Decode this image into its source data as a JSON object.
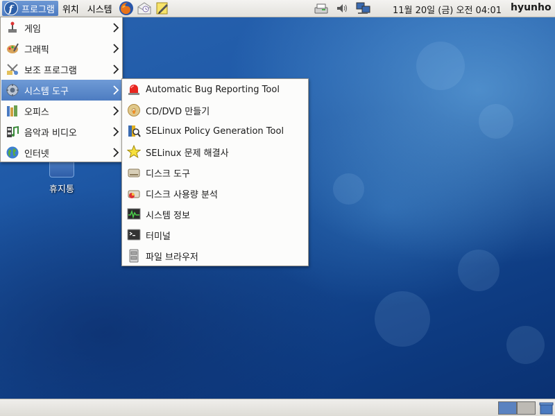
{
  "top_panel": {
    "applications_label": "프로그램",
    "places_label": "위치",
    "system_label": "시스템",
    "clock": "11월 20일 (금) 오전 04:01",
    "user": "hyunho"
  },
  "applications_menu": {
    "items": [
      {
        "label": "게임",
        "icon": "games-icon"
      },
      {
        "label": "그래픽",
        "icon": "graphics-icon"
      },
      {
        "label": "보조 프로그램",
        "icon": "accessories-icon"
      },
      {
        "label": "시스템 도구",
        "icon": "system-tools-icon"
      },
      {
        "label": "오피스",
        "icon": "office-icon"
      },
      {
        "label": "음악과 비디오",
        "icon": "sound-video-icon"
      },
      {
        "label": "인터넷",
        "icon": "internet-icon"
      }
    ],
    "selected_index": 3
  },
  "system_tools_submenu": {
    "items": [
      {
        "label": "Automatic Bug Reporting Tool",
        "icon": "alarm-icon"
      },
      {
        "label": "CD/DVD 만들기",
        "icon": "disc-burner-icon"
      },
      {
        "label": "SELinux Policy Generation Tool",
        "icon": "policy-tool-icon"
      },
      {
        "label": "SELinux 문제 해결사",
        "icon": "star-icon"
      },
      {
        "label": "디스크 도구",
        "icon": "disk-utility-icon"
      },
      {
        "label": "디스크 사용량 분석",
        "icon": "disk-usage-icon"
      },
      {
        "label": "시스템 정보",
        "icon": "system-monitor-icon"
      },
      {
        "label": "터미널",
        "icon": "terminal-icon"
      },
      {
        "label": "파일 브라우저",
        "icon": "file-browser-icon"
      }
    ]
  },
  "desktop": {
    "trash_label": "휴지통"
  },
  "colors": {
    "menu_highlight": "#5a88ca",
    "panel": "#e9e7e2"
  }
}
